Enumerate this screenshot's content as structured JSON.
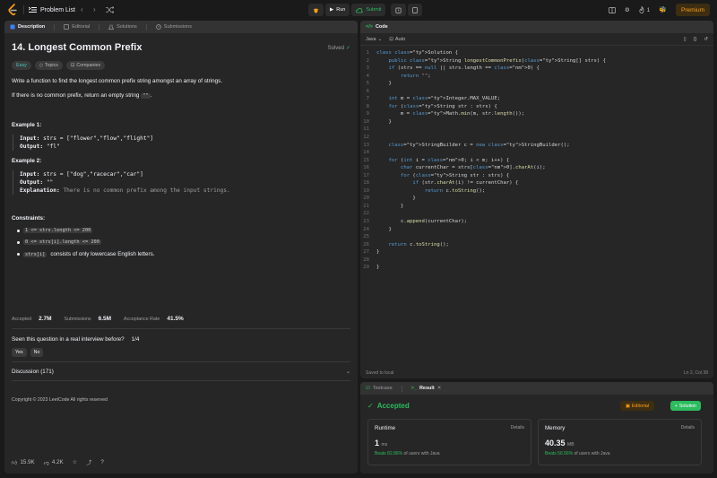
{
  "header": {
    "problem_list": "Problem List",
    "run": "Run",
    "submit": "Submit",
    "streak": "1",
    "premium": "Premium"
  },
  "left_tabs": [
    "Description",
    "Editorial",
    "Solutions",
    "Submissions"
  ],
  "problem": {
    "title": "14. Longest Common Prefix",
    "status": "Solved",
    "difficulty": "Easy",
    "tags_label": "Topics",
    "companies_label": "Companies",
    "desc1": "Write a function to find the longest common prefix string amongst an array of strings.",
    "desc2_pre": "If there is no common prefix, return an empty string ",
    "desc2_code": "\"\"",
    "desc2_post": ".",
    "ex1_title": "Example 1:",
    "ex1_input_label": "Input:",
    "ex1_input": "strs = [\"flower\",\"flow\",\"flight\"]",
    "ex1_output_label": "Output:",
    "ex1_output": "\"fl\"",
    "ex2_title": "Example 2:",
    "ex2_input_label": "Input:",
    "ex2_input": "strs = [\"dog\",\"racecar\",\"car\"]",
    "ex2_output_label": "Output:",
    "ex2_output": "\"\"",
    "ex2_expl_label": "Explanation:",
    "ex2_expl": "There is no common prefix among the input strings.",
    "constraints_title": "Constraints:",
    "c1": "1 <= strs.length <= 200",
    "c2": "0 <= strs[i].length <= 200",
    "c3_code": "strs[i]",
    "c3_text": "consists of only lowercase English letters.",
    "accepted_label": "Accepted",
    "accepted_val": "2.7M",
    "submissions_label": "Submissions",
    "submissions_val": "6.5M",
    "rate_label": "Acceptance Rate",
    "rate_val": "41.5%",
    "interview_q": "Seen this question in a real interview before?",
    "interview_page": "1/4",
    "yes": "Yes",
    "no": "No",
    "discussion": "Discussion (171)",
    "copyright": "Copyright © 2023 LeetCode All rights reserved",
    "likes": "15.9K",
    "dislikes": "4.2K"
  },
  "code": {
    "tab": "Code",
    "language": "Java",
    "mode": "Auto",
    "saved": "Saved to local",
    "cursor": "Ln 2, Col 38",
    "lines": [
      "class Solution {",
      "    public String longestCommonPrefix(String[] strs) {",
      "    if (strs == null || strs.length == 0) {",
      "        return \"\";",
      "    }",
      "",
      "    int m = Integer.MAX_VALUE;",
      "    for (String str : strs) {",
      "        m = Math.min(m, str.length());",
      "    }",
      "",
      "",
      "    StringBuilder c = new StringBuilder();",
      "",
      "    for (int i = 0; i < m; i++) {",
      "        char currentChar = strs[0].charAt(i);",
      "        for (String str : strs) {",
      "            if (str.charAt(i) != currentChar) {",
      "                return c.toString();",
      "            }",
      "        }",
      "",
      "        c.append(currentChar);",
      "    }",
      "",
      "    return c.toString();",
      "}",
      "",
      "}"
    ]
  },
  "result": {
    "testcase_tab": "Testcase",
    "result_tab": "Result",
    "status": "Accepted",
    "editorial": "Editorial",
    "solution": "Solution",
    "runtime_label": "Runtime",
    "runtime_val": "1",
    "runtime_unit": "ms",
    "runtime_beats": "Beats 82.86%",
    "runtime_beats_suffix": "of users with Java",
    "memory_label": "Memory",
    "memory_val": "40.35",
    "memory_unit": "MB",
    "memory_beats": "Beats 56.56%",
    "memory_beats_suffix": "of users with Java",
    "details": "Details"
  },
  "colors": {
    "accent_green": "#2cbb5d",
    "accent_orange": "#ffa116",
    "easy_teal": "#46c6c2"
  }
}
